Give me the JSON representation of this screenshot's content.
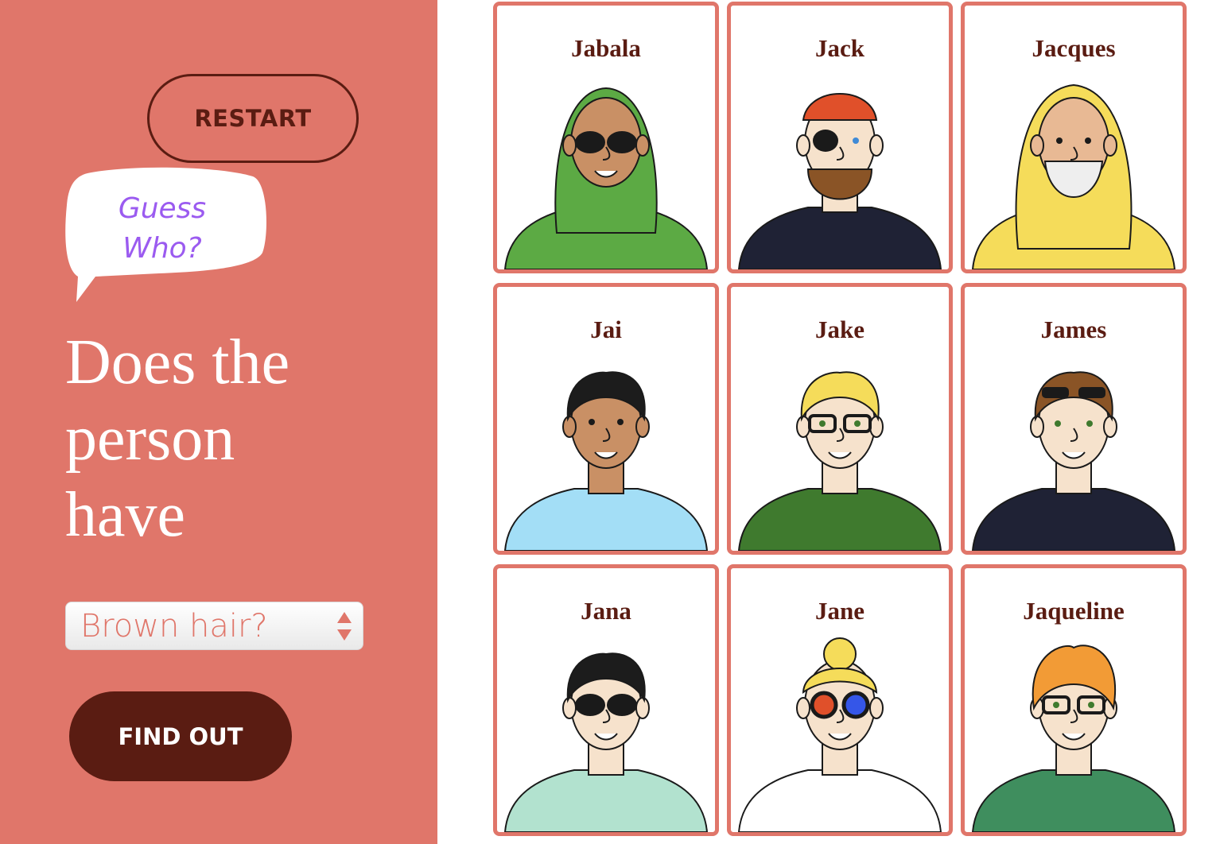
{
  "sidebar": {
    "restart_label": "RESTART",
    "bubble_line1": "Guess",
    "bubble_line2": "Who?",
    "question_line1": "Does the",
    "question_line2": "person",
    "question_line3": "have",
    "select_value": "Brown hair?",
    "find_out_label": "FIND OUT"
  },
  "colors": {
    "sidebar_bg": "#e0766a",
    "dark_accent": "#5a1c12",
    "bubble_text": "#9b5bf0",
    "card_border": "#e0766a"
  },
  "characters": [
    {
      "name": "Jabala",
      "hair": "#5caa44",
      "skin": "#c99065",
      "shirt": "#5caa44",
      "glasses": "sunglasses"
    },
    {
      "name": "Jack",
      "hair": "#e0502a",
      "skin": "#f6e2cc",
      "shirt": "#1f2235",
      "glasses": "eyepatch"
    },
    {
      "name": "Jacques",
      "hair": "#f5dc5a",
      "skin": "#e8b994",
      "shirt": "#f5dc5a",
      "glasses": "none"
    },
    {
      "name": "Jai",
      "hair": "#1c1c1c",
      "skin": "#c99065",
      "shirt": "#a3def6",
      "glasses": "none"
    },
    {
      "name": "Jake",
      "hair": "#f5dc5a",
      "skin": "#f6e2cc",
      "shirt": "#3f7a2e",
      "glasses": "glasses"
    },
    {
      "name": "James",
      "hair": "#8a5426",
      "skin": "#f6e2cc",
      "shirt": "#1f2235",
      "glasses": "sunglasses-on-head"
    },
    {
      "name": "Jana",
      "hair": "#1c1c1c",
      "skin": "#f6e2cc",
      "shirt": "#b2e2cf",
      "glasses": "sunglasses"
    },
    {
      "name": "Jane",
      "hair": "#f5dc5a",
      "skin": "#f6e2cc",
      "shirt": "#ffffff",
      "glasses": "3d-glasses"
    },
    {
      "name": "Jaqueline",
      "hair": "#f29b36",
      "skin": "#f6e2cc",
      "shirt": "#3f8e5e",
      "glasses": "glasses"
    }
  ]
}
